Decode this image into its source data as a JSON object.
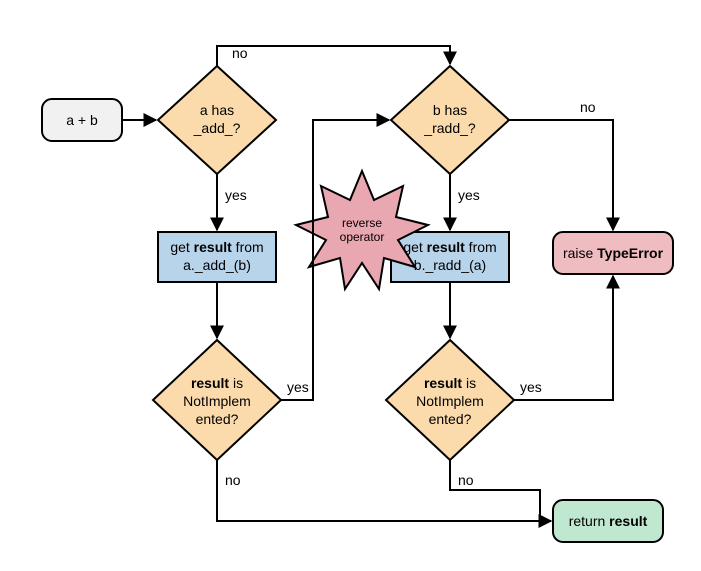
{
  "nodes": {
    "start": {
      "line1": "a + b"
    },
    "d1": {
      "line1": "a has",
      "line2": "_add_?"
    },
    "d2": {
      "line1": "b has",
      "line2": "_radd_?"
    },
    "p1": {
      "line1_a": "get ",
      "line1_b": "result",
      "line1_c": " from",
      "line2": "a._add_(b)"
    },
    "p2": {
      "line1_a": "get ",
      "line1_b": "result",
      "line1_c": " from",
      "line2": "b._radd_(a)"
    },
    "d3": {
      "line1_b": "result",
      "line1_c": " is",
      "line2": "NotImplem",
      "line3": "ented?"
    },
    "d4": {
      "line1_b": "result",
      "line1_c": " is",
      "line2": "NotImplem",
      "line3": "ented?"
    },
    "err": {
      "text_a": "raise ",
      "text_b": "TypeError"
    },
    "ret": {
      "text_a": "return ",
      "text_b": "result"
    },
    "star": {
      "line1": "reverse",
      "line2": "operator"
    }
  },
  "edges": {
    "yes": "yes",
    "no": "no"
  },
  "colors": {
    "diamond_fill": "#fbdbab",
    "process_fill": "#b8d4ea",
    "start_fill": "#f1f1f1",
    "error_fill": "#efbcc2",
    "return_fill": "#c0e7cf",
    "star_fill": "#e9a7b2",
    "stroke": "#000000"
  }
}
